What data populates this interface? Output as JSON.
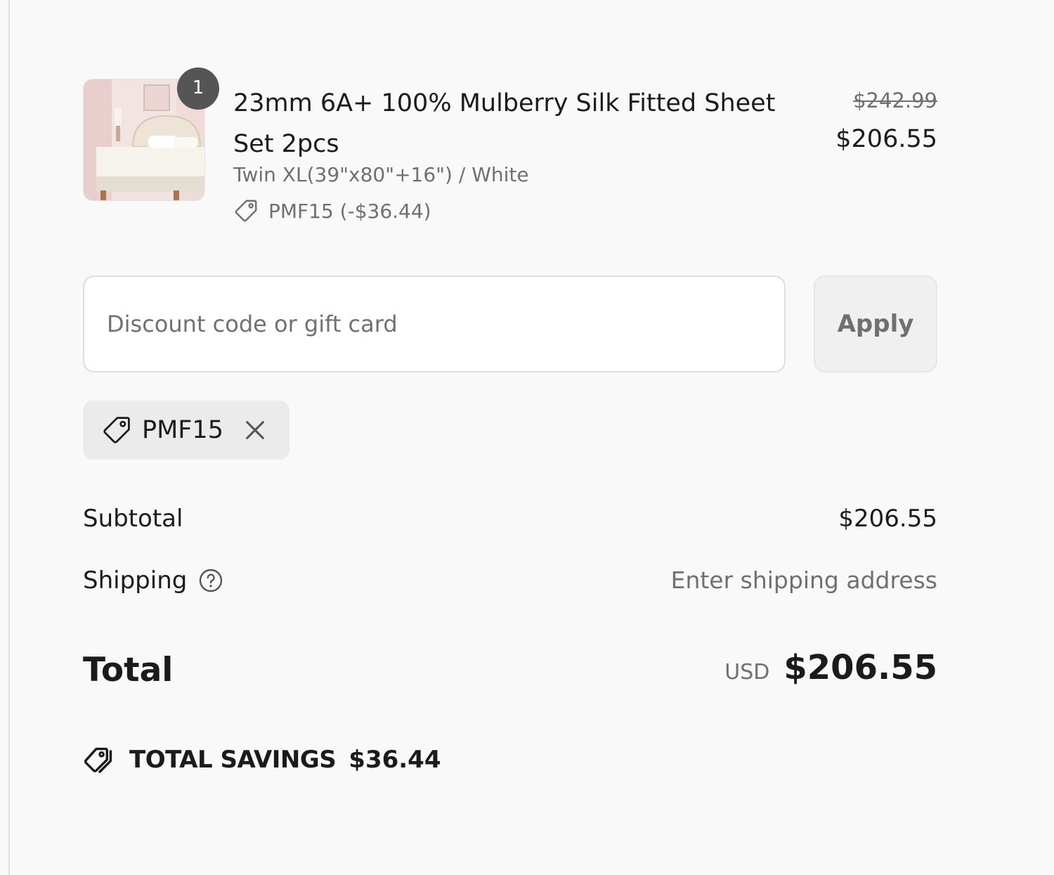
{
  "product": {
    "quantity": "1",
    "title": "23mm 6A+ 100% Mulberry Silk Fitted Sheet Set 2pcs",
    "variant": "Twin XL(39\"x80\"+16\") / White",
    "discount": "PMF15 (-$36.44)",
    "original_price": "$242.99",
    "price": "$206.55",
    "image_icon": "bed-product-image"
  },
  "discount_form": {
    "placeholder": "Discount code or gift card",
    "value": "",
    "apply_label": "Apply"
  },
  "applied_code": {
    "label": "PMF15",
    "tag_icon": "tag-icon",
    "remove_icon": "close-icon"
  },
  "totals": {
    "subtotal_label": "Subtotal",
    "subtotal_value": "$206.55",
    "shipping_label": "Shipping",
    "shipping_value": "Enter shipping address",
    "total_label": "Total",
    "currency": "USD",
    "total_value": "$206.55",
    "savings_label": "TOTAL SAVINGS",
    "savings_value": "$36.44"
  },
  "colors": {
    "background": "#f9f9f9",
    "text_primary": "#1b1b1b",
    "text_secondary": "#707070",
    "badge": "#555555",
    "chip_bg": "#ebebeb"
  }
}
